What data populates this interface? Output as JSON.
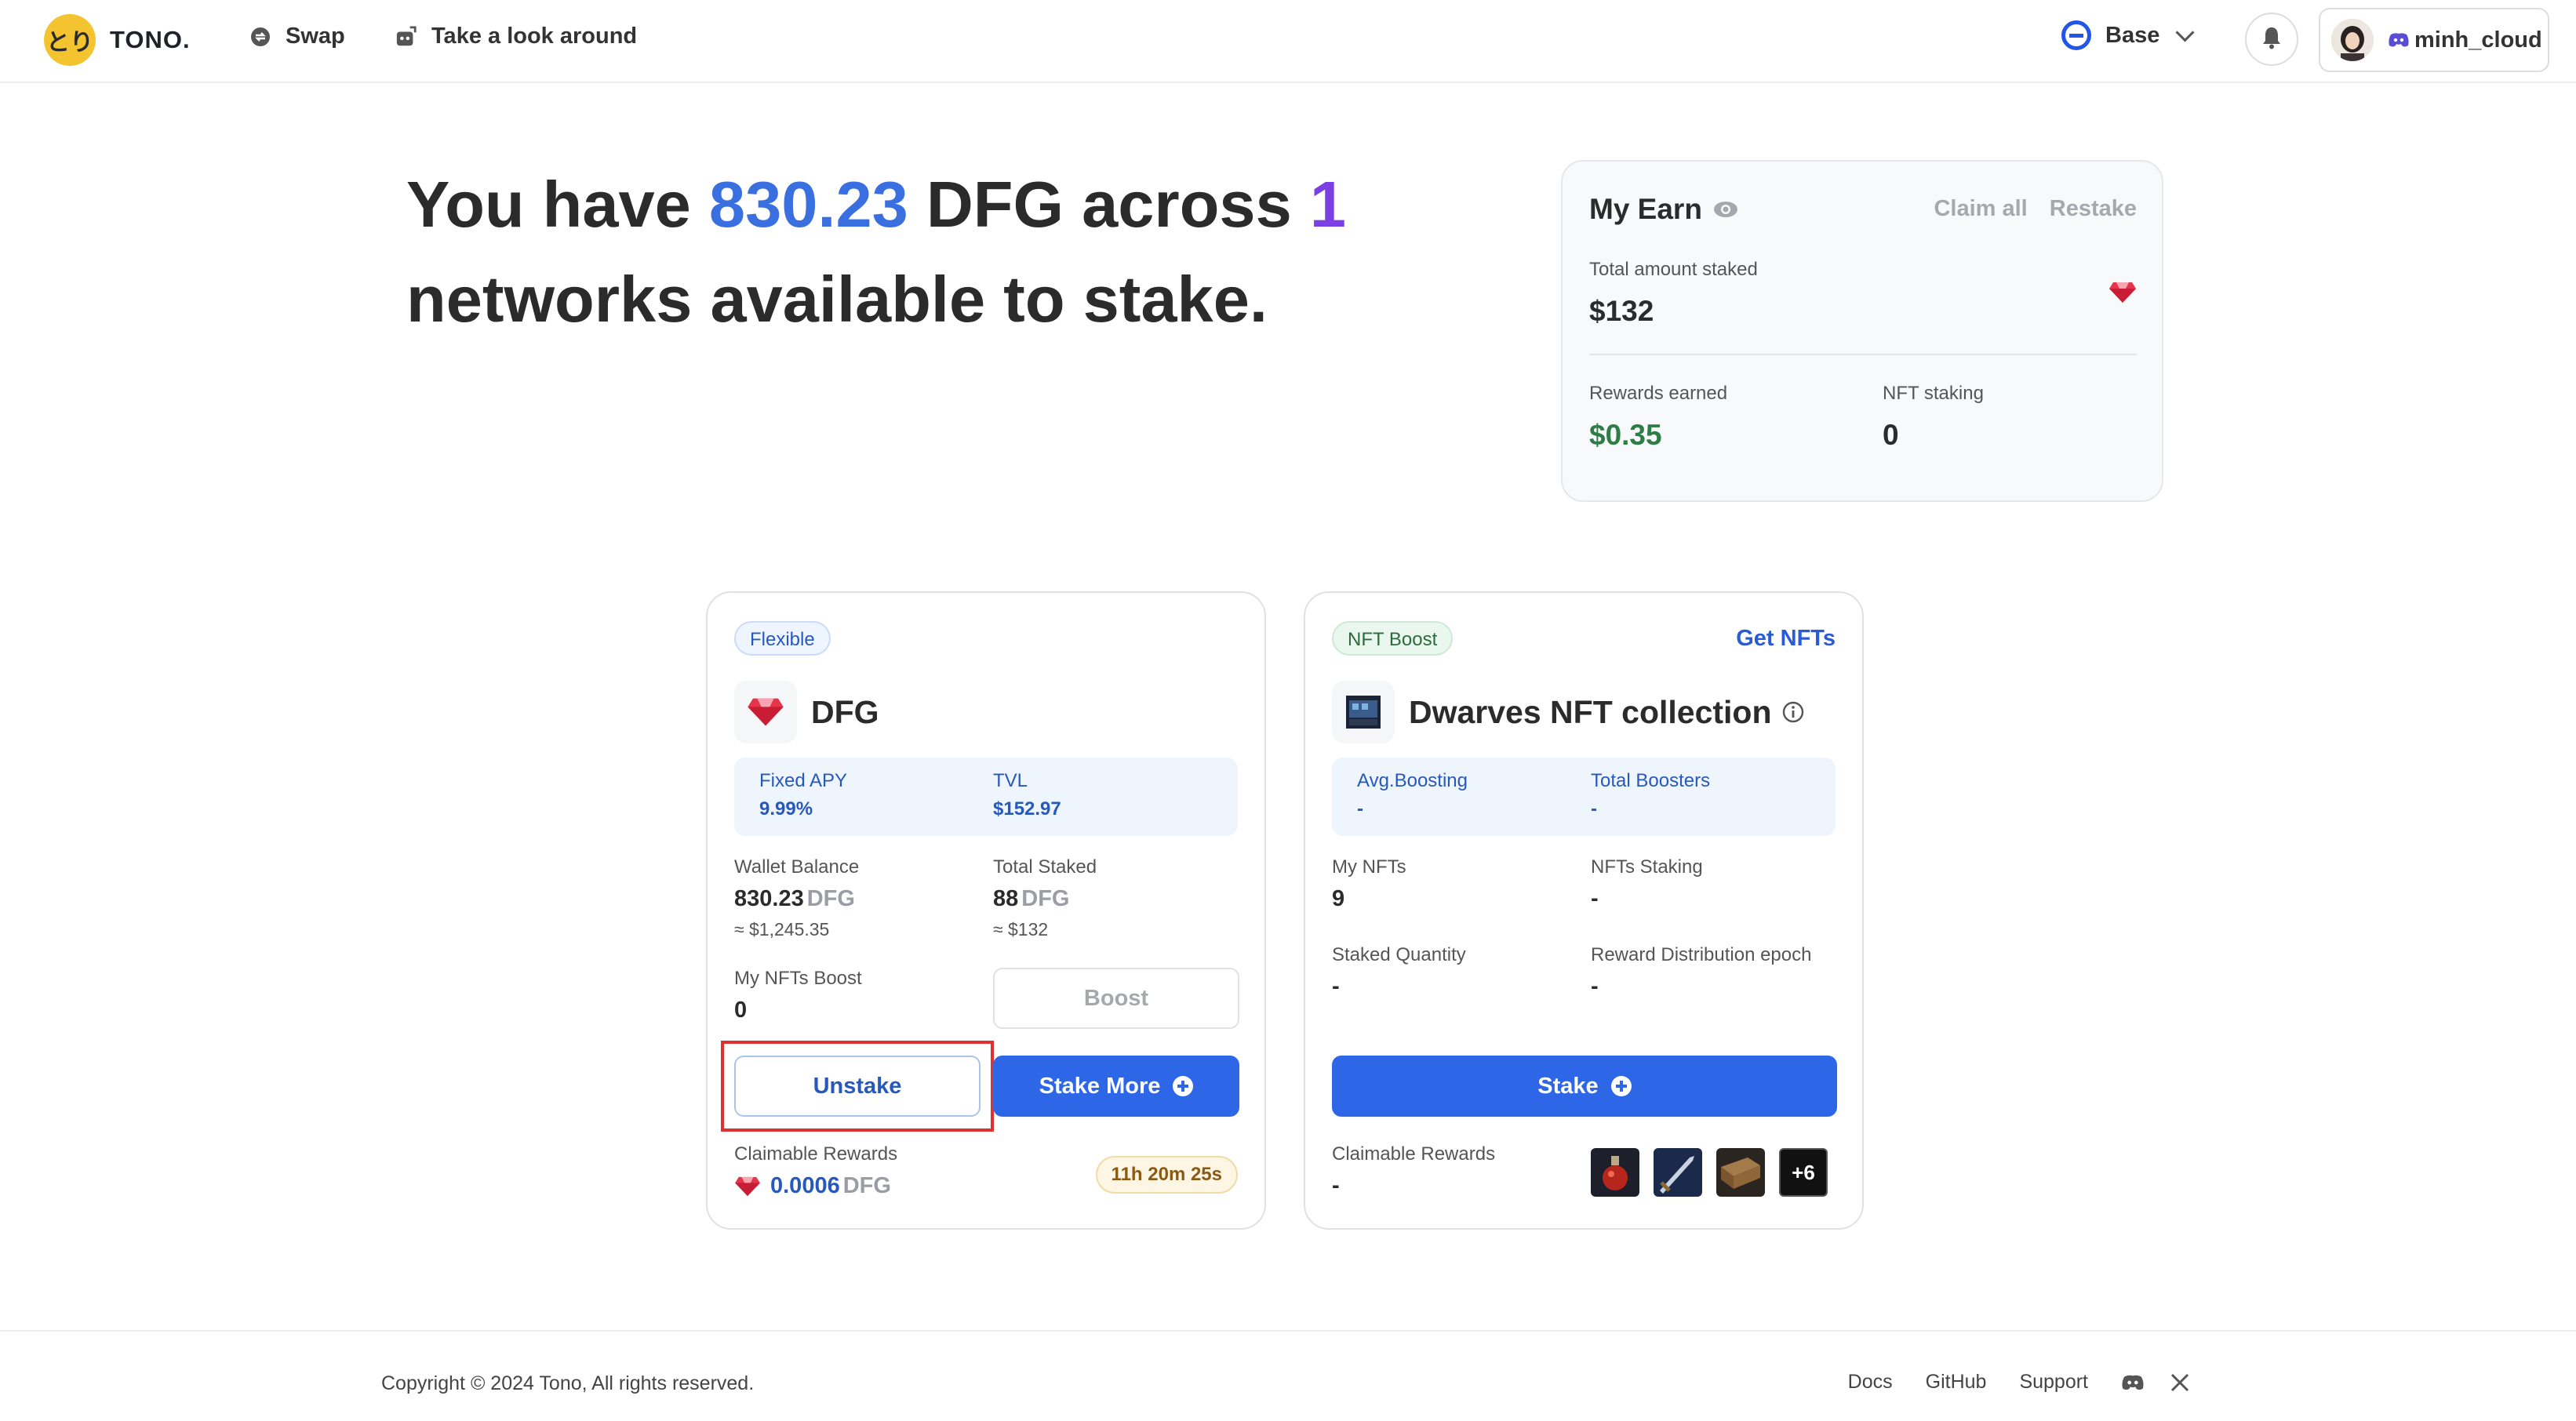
{
  "nav": {
    "brand": "TONO.",
    "logo_text": "とり",
    "links": [
      {
        "label": "Swap",
        "icon": "swap-icon"
      },
      {
        "label": "Take a look around",
        "icon": "tour-icon"
      }
    ],
    "network": "Base",
    "username": "minh_cloud"
  },
  "hero": {
    "part1": "You have ",
    "amount": "830.23",
    "part2": " DFG across ",
    "networks": "1",
    "part3": " networks available to stake."
  },
  "earn": {
    "title": "My Earn",
    "claim_all": "Claim all",
    "restake": "Restake",
    "total_staked_label": "Total amount staked",
    "total_staked_value": "$132",
    "rewards_label": "Rewards earned",
    "rewards_value": "$0.35",
    "nft_staking_label": "NFT staking",
    "nft_staking_value": "0"
  },
  "flexible_card": {
    "tag": "Flexible",
    "token": "DFG",
    "apy_label": "Fixed APY",
    "apy_value": "9.99%",
    "tvl_label": "TVL",
    "tvl_value": "$152.97",
    "wallet_label": "Wallet Balance",
    "wallet_value": "830.23",
    "wallet_unit": "DFG",
    "wallet_usd": "≈ $1,245.35",
    "staked_label": "Total Staked",
    "staked_value": "88",
    "staked_unit": "DFG",
    "staked_usd": "≈ $132",
    "boost_label": "My NFTs Boost",
    "boost_value": "0",
    "boost_button": "Boost",
    "unstake_button": "Unstake",
    "stake_more_button": "Stake More",
    "claimable_label": "Claimable Rewards",
    "claimable_value": "0.0006",
    "claimable_unit": "DFG",
    "timer": "11h 20m 25s"
  },
  "nft_card": {
    "tag": "NFT Boost",
    "get_nfts": "Get NFTs",
    "title": "Dwarves NFT collection",
    "avg_label": "Avg.Boosting",
    "avg_value": "-",
    "boosters_label": "Total Boosters",
    "boosters_value": "-",
    "my_nfts_label": "My NFTs",
    "my_nfts_value": "9",
    "nfts_staking_label": "NFTs Staking",
    "nfts_staking_value": "-",
    "staked_qty_label": "Staked Quantity",
    "staked_qty_value": "-",
    "epoch_label": "Reward Distribution epoch",
    "epoch_value": "-",
    "stake_button": "Stake",
    "claimable_label": "Claimable Rewards",
    "claimable_value": "-",
    "more_count": "+6"
  },
  "footer": {
    "copyright": "Copyright © 2024 Tono, All rights reserved.",
    "links": [
      "Docs",
      "GitHub",
      "Support"
    ]
  },
  "colors": {
    "primary": "#2d66e6",
    "hero_amount": "#3a6fe0",
    "hero_networks": "#7b3fe4",
    "reward_green": "#2f7d46",
    "highlight": "#e03030"
  }
}
